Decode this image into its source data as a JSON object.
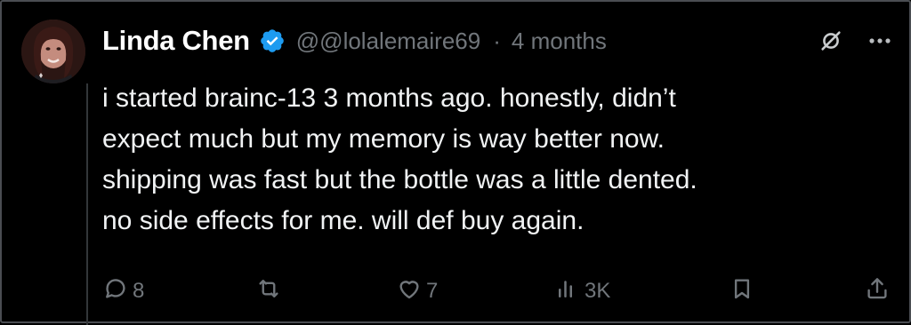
{
  "tweet": {
    "author_name": "Linda Chen",
    "handle": "@@lolalemaire69",
    "separator": "·",
    "time": "4 months",
    "body": "i started brainc-13 3 months ago. honestly, didn’t\nexpect much but my memory is way better now.\nshipping was fast but the bottle was a little dented.\nno side effects for me. will def buy again.",
    "verified_color": "#1d9bf0"
  },
  "actions": {
    "replies": "8",
    "retweets": "",
    "likes": "7",
    "views": "3K"
  },
  "icons": {
    "verified": "verified-badge-icon",
    "grok": "grok-icon",
    "more": "more-icon",
    "reply": "reply-icon",
    "retweet": "retweet-icon",
    "like": "heart-icon",
    "views": "views-icon",
    "bookmark": "bookmark-icon",
    "share": "share-icon"
  }
}
